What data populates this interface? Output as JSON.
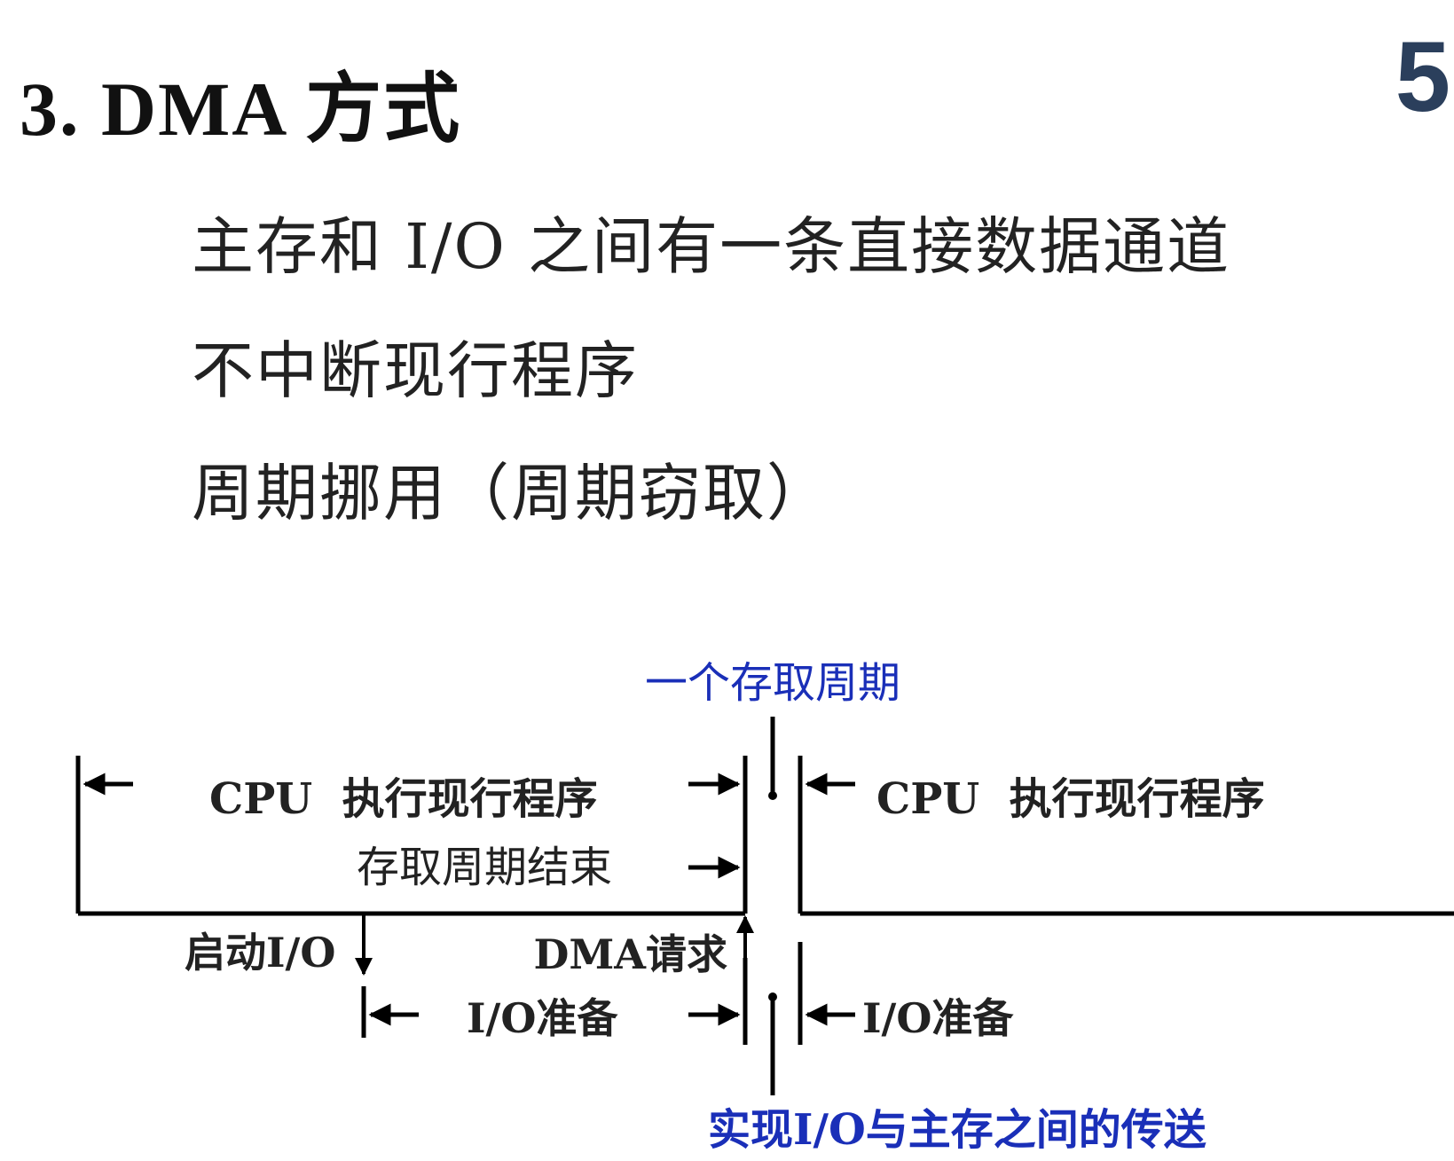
{
  "slide": {
    "title": "3. DMA 方式",
    "page_number": "5",
    "bullets": [
      "主存和 I/O 之间有一条直接数据通道",
      "不中断现行程序",
      "周期挪用（周期窃取）"
    ]
  },
  "diagram": {
    "access_cycle_label": "一个存取周期",
    "cpu_exec_left": "CPU  执行现行程序",
    "cpu_exec_right": "CPU  执行现行程序",
    "access_cycle_end": "存取周期结束",
    "start_io": "启动I/O",
    "dma_request": "DMA请求",
    "io_prep_left": "I/O准备",
    "io_prep_right": "I/O准备",
    "transfer_label": "实现I/O与主存之间的传送",
    "colors": {
      "line": "#000000",
      "accent_blue": "#1a2fb8",
      "text": "#222222"
    }
  }
}
